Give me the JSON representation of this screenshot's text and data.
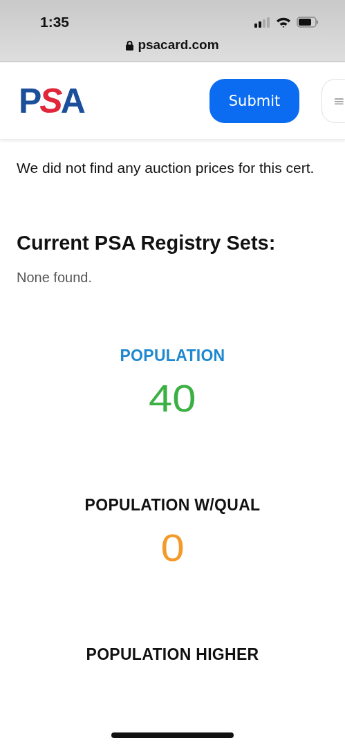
{
  "status_bar": {
    "time": "1:35",
    "url": "psacard.com"
  },
  "header": {
    "logo": "PSA",
    "button": "Submit",
    "menu_icon": "≡"
  },
  "auction_note": "We did not find any auction prices for this cert.",
  "registry": {
    "heading": "Current PSA Registry Sets:",
    "text": "None found."
  },
  "stats": [
    {
      "label": "POPULATION",
      "kind": "highlight",
      "value": "40",
      "color": "#3cb043"
    },
    {
      "label": "POPULATION W/QUAL",
      "kind": "plain",
      "value": "0",
      "color": "#f39a2b"
    },
    {
      "label": "POPULATION HIGHER",
      "kind": "plain"
    }
  ]
}
